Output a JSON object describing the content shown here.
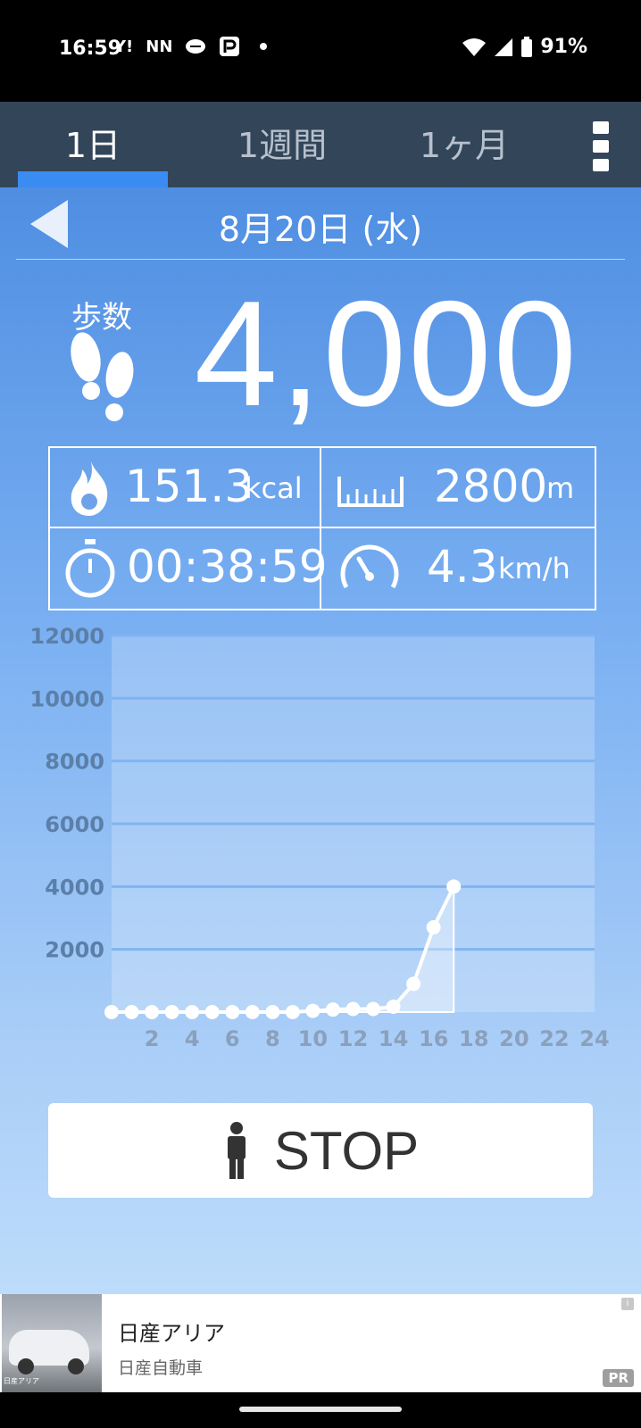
{
  "status_bar": {
    "time": "16:59",
    "notification_icons": [
      "Y!",
      "NN",
      "line-icon",
      "paypay-icon"
    ],
    "battery": "91%"
  },
  "tabs": [
    {
      "label": "1日",
      "active": true
    },
    {
      "label": "1週間",
      "active": false
    },
    {
      "label": "1ヶ月",
      "active": false
    }
  ],
  "date": "8月20日 (水)",
  "steps": {
    "label": "歩数",
    "value": "4,000"
  },
  "stats": {
    "calories": {
      "value": "151.3",
      "unit": "kcal"
    },
    "distance": {
      "value": "2800",
      "unit": "m"
    },
    "time": {
      "value": "00:38:59",
      "unit": ""
    },
    "speed": {
      "value": "4.3",
      "unit": "km/h"
    }
  },
  "chart_data": {
    "type": "line",
    "title": "",
    "xlabel": "",
    "ylabel": "",
    "xlim": [
      0,
      24
    ],
    "ylim": [
      0,
      12000
    ],
    "x_ticks": [
      2,
      4,
      6,
      8,
      10,
      12,
      14,
      16,
      18,
      20,
      22,
      24
    ],
    "y_ticks": [
      2000,
      4000,
      6000,
      8000,
      10000,
      12000
    ],
    "series": [
      {
        "x": [
          0,
          1,
          2,
          3,
          4,
          5,
          6,
          7,
          8,
          9,
          10,
          11,
          12,
          13,
          14,
          15,
          16,
          17
        ],
        "values": [
          0,
          0,
          0,
          0,
          0,
          0,
          0,
          0,
          0,
          0,
          40,
          80,
          100,
          100,
          170,
          900,
          2700,
          4000
        ]
      }
    ],
    "grid": true,
    "colors": {
      "line": "#ffffff",
      "grid": "#7fb4f2"
    }
  },
  "stop_button": {
    "label": "STOP"
  },
  "ad": {
    "title": "日産アリア",
    "advertiser": "日産自動車",
    "badge": "PR",
    "info": "i",
    "image_caption": "日産アリア"
  },
  "colors": {
    "tabbar": "#334558",
    "tab_accent": "#3b8cf2",
    "main_top": "#4f8ee2",
    "main_bottom": "#bddcfb"
  }
}
